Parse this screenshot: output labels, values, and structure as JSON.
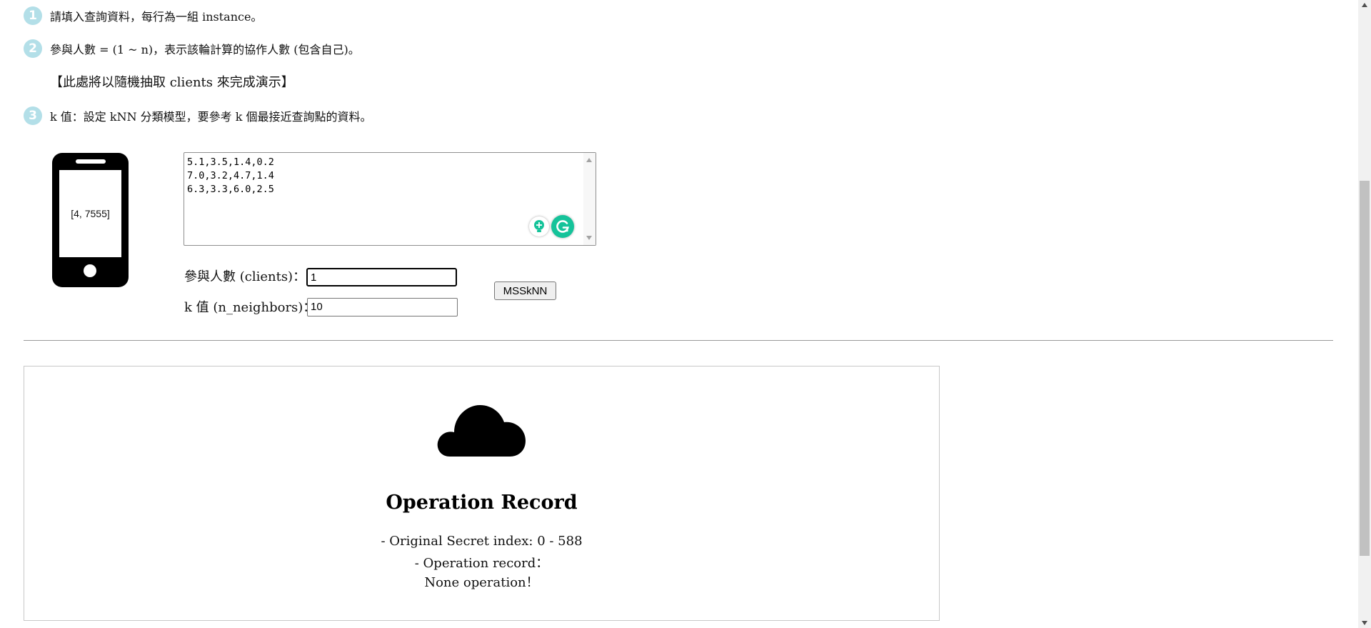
{
  "steps": [
    {
      "num": "1",
      "text": "請填入查詢資料，每行為一組 instance。"
    },
    {
      "num": "2",
      "text": "參與人數 = (1 ~ n)，表示該輪計算的協作人數 (包含自己)。"
    },
    {
      "num": "3",
      "text": "k 值：設定 kNN 分類模型，要參考 k 個最接近查詢點的資料。"
    }
  ],
  "note": "【此處將以隨機抽取 clients 來完成演示】",
  "phone": {
    "screen_text": "[4, 7555]"
  },
  "query_box": {
    "value": "5.1,3.5,1.4,0.2\n7.0,3.2,4.7,1.4\n6.3,3.3,6.0,2.5"
  },
  "form": {
    "clients_label": "參與人數 (clients)：",
    "clients_value": "1",
    "neighbors_label": "k 值 (n_neighbors)：",
    "neighbors_value": "10",
    "submit_label": "MSSkNN"
  },
  "record": {
    "title": "Operation Record",
    "line1": "- Original Secret index: 0 - 588",
    "line2": "- Operation record：",
    "line3": "None operation！"
  },
  "colors": {
    "step_badge": "#b3dfe8",
    "grammarly": "#15c39a"
  }
}
